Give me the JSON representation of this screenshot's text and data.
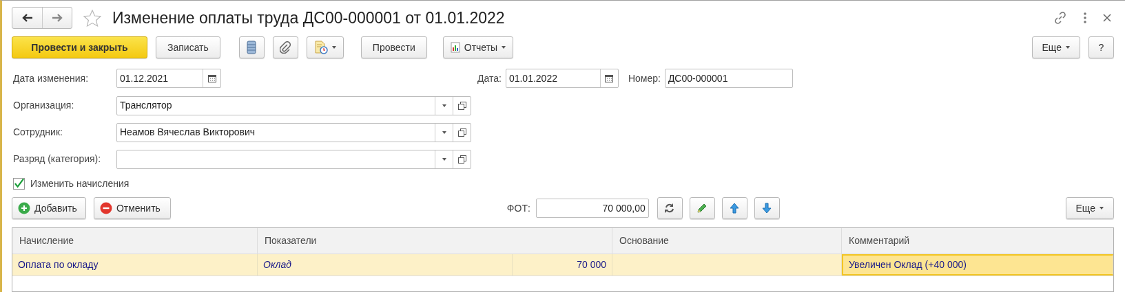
{
  "window": {
    "title": "Изменение оплаты труда ДС00-000001 от 01.01.2022",
    "favorite": false
  },
  "toolbar": {
    "buttons": [
      {
        "kind": "primary",
        "label": "Провести и закрыть"
      },
      {
        "kind": "text",
        "label": "Записать"
      },
      {
        "kind": "icon"
      },
      {
        "kind": "icon"
      },
      {
        "kind": "icon-menu"
      },
      {
        "kind": "text",
        "label": "Провести"
      },
      {
        "kind": "icon-text-menu",
        "label": "Отчеты"
      }
    ],
    "more": "Еще",
    "help": "?"
  },
  "header_fields": {
    "change_date": {
      "label": "Дата изменения:",
      "value": "01.12.2021"
    },
    "date": {
      "label": "Дата:",
      "value": "01.01.2022"
    },
    "number": {
      "label": "Номер:",
      "value": "ДС00-000001"
    }
  },
  "fields": [
    {
      "label": "Организация:",
      "value": "Транслятор"
    },
    {
      "label": "Сотрудник:",
      "value": "Неамов Вячеслав Викторович"
    },
    {
      "label": "Разряд (категория):"
    }
  ],
  "change_accruals": {
    "label": "Изменить начисления",
    "checked": true
  },
  "table_toolbar": {
    "add": "Добавить",
    "cancel": "Отменить",
    "fot_label": "ФОТ:",
    "fot_value": "70 000,00",
    "more": "Еще"
  },
  "table": {
    "columns": [
      "Начисление",
      "Показатели",
      "Основание",
      "Комментарий"
    ],
    "rows": [
      {
        "accrual": "Оплата по окладу",
        "indicator": "Оклад",
        "indicator_value": "70 000",
        "comment": "Увеличен Оклад (+40 000)",
        "selected": true
      }
    ]
  }
}
